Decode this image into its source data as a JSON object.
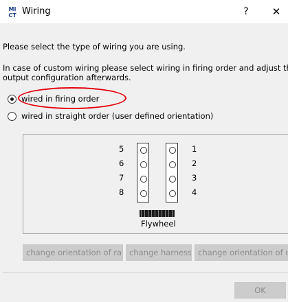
{
  "window": {
    "title": "Wiring",
    "logo_text": "MI CT",
    "help_label": "?",
    "close_label": "✕"
  },
  "messages": {
    "select_type": "Please select the type of wiring you are using.",
    "custom_wiring": "In case of custom wiring please select wiring in firing order and adjust the output configuration afterwards."
  },
  "wiring_options": {
    "selected": "firing_order",
    "firing_order_label": "wired in firing order",
    "straight_order_label": "wired in straight order (user defined orientation)"
  },
  "diagram": {
    "left_cylinders": [
      "5",
      "6",
      "7",
      "8"
    ],
    "right_cylinders": [
      "1",
      "2",
      "3",
      "4"
    ],
    "flywheel_label": "Flywheel"
  },
  "buttons": {
    "change_orientation_left": "change orientation of rail",
    "change_harness": "change harness",
    "change_orientation_right": "change orientation of rail",
    "ok": "OK"
  },
  "colors": {
    "highlight": "#e3000f",
    "disabled_button_bg": "#cccccc",
    "disabled_button_text": "#8c8c8c",
    "dialog_bg": "#f0f0f0"
  }
}
